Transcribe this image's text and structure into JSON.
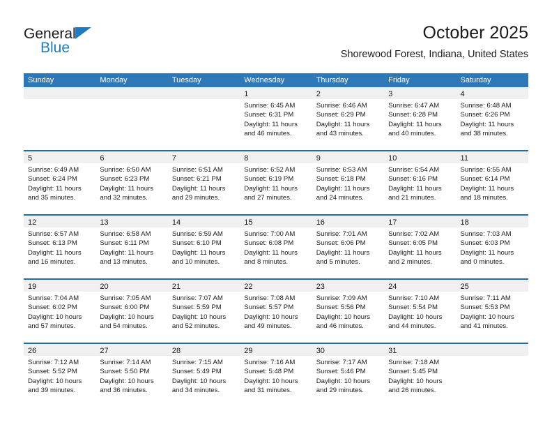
{
  "brand": {
    "name_top": "General",
    "name_bottom": "Blue",
    "accent_color": "#1f7bc1"
  },
  "header": {
    "title": "October 2025",
    "subtitle": "Shorewood Forest, Indiana, United States"
  },
  "colors": {
    "header_blue": "#2e78b8",
    "row_divider_blue": "#1f6cb0",
    "daynum_band": "#f0f0f0",
    "text": "#1a1a1a"
  },
  "weekdays": [
    "Sunday",
    "Monday",
    "Tuesday",
    "Wednesday",
    "Thursday",
    "Friday",
    "Saturday"
  ],
  "weeks": [
    [
      {
        "day": "",
        "sunrise": "",
        "sunset": "",
        "daylight1": "",
        "daylight2": ""
      },
      {
        "day": "",
        "sunrise": "",
        "sunset": "",
        "daylight1": "",
        "daylight2": ""
      },
      {
        "day": "",
        "sunrise": "",
        "sunset": "",
        "daylight1": "",
        "daylight2": ""
      },
      {
        "day": "1",
        "sunrise": "Sunrise: 6:45 AM",
        "sunset": "Sunset: 6:31 PM",
        "daylight1": "Daylight: 11 hours",
        "daylight2": "and 46 minutes."
      },
      {
        "day": "2",
        "sunrise": "Sunrise: 6:46 AM",
        "sunset": "Sunset: 6:29 PM",
        "daylight1": "Daylight: 11 hours",
        "daylight2": "and 43 minutes."
      },
      {
        "day": "3",
        "sunrise": "Sunrise: 6:47 AM",
        "sunset": "Sunset: 6:28 PM",
        "daylight1": "Daylight: 11 hours",
        "daylight2": "and 40 minutes."
      },
      {
        "day": "4",
        "sunrise": "Sunrise: 6:48 AM",
        "sunset": "Sunset: 6:26 PM",
        "daylight1": "Daylight: 11 hours",
        "daylight2": "and 38 minutes."
      }
    ],
    [
      {
        "day": "5",
        "sunrise": "Sunrise: 6:49 AM",
        "sunset": "Sunset: 6:24 PM",
        "daylight1": "Daylight: 11 hours",
        "daylight2": "and 35 minutes."
      },
      {
        "day": "6",
        "sunrise": "Sunrise: 6:50 AM",
        "sunset": "Sunset: 6:23 PM",
        "daylight1": "Daylight: 11 hours",
        "daylight2": "and 32 minutes."
      },
      {
        "day": "7",
        "sunrise": "Sunrise: 6:51 AM",
        "sunset": "Sunset: 6:21 PM",
        "daylight1": "Daylight: 11 hours",
        "daylight2": "and 29 minutes."
      },
      {
        "day": "8",
        "sunrise": "Sunrise: 6:52 AM",
        "sunset": "Sunset: 6:19 PM",
        "daylight1": "Daylight: 11 hours",
        "daylight2": "and 27 minutes."
      },
      {
        "day": "9",
        "sunrise": "Sunrise: 6:53 AM",
        "sunset": "Sunset: 6:18 PM",
        "daylight1": "Daylight: 11 hours",
        "daylight2": "and 24 minutes."
      },
      {
        "day": "10",
        "sunrise": "Sunrise: 6:54 AM",
        "sunset": "Sunset: 6:16 PM",
        "daylight1": "Daylight: 11 hours",
        "daylight2": "and 21 minutes."
      },
      {
        "day": "11",
        "sunrise": "Sunrise: 6:55 AM",
        "sunset": "Sunset: 6:14 PM",
        "daylight1": "Daylight: 11 hours",
        "daylight2": "and 18 minutes."
      }
    ],
    [
      {
        "day": "12",
        "sunrise": "Sunrise: 6:57 AM",
        "sunset": "Sunset: 6:13 PM",
        "daylight1": "Daylight: 11 hours",
        "daylight2": "and 16 minutes."
      },
      {
        "day": "13",
        "sunrise": "Sunrise: 6:58 AM",
        "sunset": "Sunset: 6:11 PM",
        "daylight1": "Daylight: 11 hours",
        "daylight2": "and 13 minutes."
      },
      {
        "day": "14",
        "sunrise": "Sunrise: 6:59 AM",
        "sunset": "Sunset: 6:10 PM",
        "daylight1": "Daylight: 11 hours",
        "daylight2": "and 10 minutes."
      },
      {
        "day": "15",
        "sunrise": "Sunrise: 7:00 AM",
        "sunset": "Sunset: 6:08 PM",
        "daylight1": "Daylight: 11 hours",
        "daylight2": "and 8 minutes."
      },
      {
        "day": "16",
        "sunrise": "Sunrise: 7:01 AM",
        "sunset": "Sunset: 6:06 PM",
        "daylight1": "Daylight: 11 hours",
        "daylight2": "and 5 minutes."
      },
      {
        "day": "17",
        "sunrise": "Sunrise: 7:02 AM",
        "sunset": "Sunset: 6:05 PM",
        "daylight1": "Daylight: 11 hours",
        "daylight2": "and 2 minutes."
      },
      {
        "day": "18",
        "sunrise": "Sunrise: 7:03 AM",
        "sunset": "Sunset: 6:03 PM",
        "daylight1": "Daylight: 11 hours",
        "daylight2": "and 0 minutes."
      }
    ],
    [
      {
        "day": "19",
        "sunrise": "Sunrise: 7:04 AM",
        "sunset": "Sunset: 6:02 PM",
        "daylight1": "Daylight: 10 hours",
        "daylight2": "and 57 minutes."
      },
      {
        "day": "20",
        "sunrise": "Sunrise: 7:05 AM",
        "sunset": "Sunset: 6:00 PM",
        "daylight1": "Daylight: 10 hours",
        "daylight2": "and 54 minutes."
      },
      {
        "day": "21",
        "sunrise": "Sunrise: 7:07 AM",
        "sunset": "Sunset: 5:59 PM",
        "daylight1": "Daylight: 10 hours",
        "daylight2": "and 52 minutes."
      },
      {
        "day": "22",
        "sunrise": "Sunrise: 7:08 AM",
        "sunset": "Sunset: 5:57 PM",
        "daylight1": "Daylight: 10 hours",
        "daylight2": "and 49 minutes."
      },
      {
        "day": "23",
        "sunrise": "Sunrise: 7:09 AM",
        "sunset": "Sunset: 5:56 PM",
        "daylight1": "Daylight: 10 hours",
        "daylight2": "and 46 minutes."
      },
      {
        "day": "24",
        "sunrise": "Sunrise: 7:10 AM",
        "sunset": "Sunset: 5:54 PM",
        "daylight1": "Daylight: 10 hours",
        "daylight2": "and 44 minutes."
      },
      {
        "day": "25",
        "sunrise": "Sunrise: 7:11 AM",
        "sunset": "Sunset: 5:53 PM",
        "daylight1": "Daylight: 10 hours",
        "daylight2": "and 41 minutes."
      }
    ],
    [
      {
        "day": "26",
        "sunrise": "Sunrise: 7:12 AM",
        "sunset": "Sunset: 5:52 PM",
        "daylight1": "Daylight: 10 hours",
        "daylight2": "and 39 minutes."
      },
      {
        "day": "27",
        "sunrise": "Sunrise: 7:14 AM",
        "sunset": "Sunset: 5:50 PM",
        "daylight1": "Daylight: 10 hours",
        "daylight2": "and 36 minutes."
      },
      {
        "day": "28",
        "sunrise": "Sunrise: 7:15 AM",
        "sunset": "Sunset: 5:49 PM",
        "daylight1": "Daylight: 10 hours",
        "daylight2": "and 34 minutes."
      },
      {
        "day": "29",
        "sunrise": "Sunrise: 7:16 AM",
        "sunset": "Sunset: 5:48 PM",
        "daylight1": "Daylight: 10 hours",
        "daylight2": "and 31 minutes."
      },
      {
        "day": "30",
        "sunrise": "Sunrise: 7:17 AM",
        "sunset": "Sunset: 5:46 PM",
        "daylight1": "Daylight: 10 hours",
        "daylight2": "and 29 minutes."
      },
      {
        "day": "31",
        "sunrise": "Sunrise: 7:18 AM",
        "sunset": "Sunset: 5:45 PM",
        "daylight1": "Daylight: 10 hours",
        "daylight2": "and 26 minutes."
      },
      {
        "day": "",
        "sunrise": "",
        "sunset": "",
        "daylight1": "",
        "daylight2": ""
      }
    ]
  ]
}
